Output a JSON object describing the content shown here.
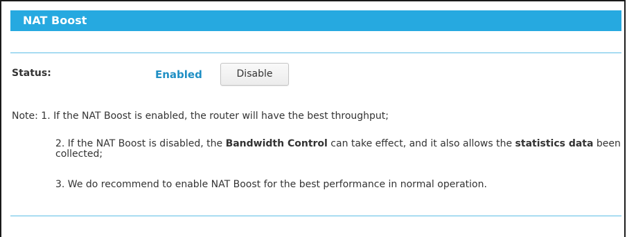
{
  "header": {
    "title": "NAT Boost"
  },
  "status": {
    "label": "Status:",
    "value": "Enabled",
    "button_label": "Disable"
  },
  "notes": {
    "n1": "Note: 1. If the NAT Boost is enabled, the router will have the best throughput;",
    "n2_part1": "2. If the NAT Boost is disabled, the ",
    "n2_bold1": "Bandwidth Control",
    "n2_part2": " can take effect, and it also allows the ",
    "n2_bold2": "statistics data",
    "n2_part3": " been collected;",
    "n3": "3. We do recommend to enable NAT Boost for the best performance in normal operation."
  },
  "colors": {
    "accent": "#26a9e0",
    "status_enabled": "#1f8fc4",
    "divider": "#5bbde6"
  }
}
